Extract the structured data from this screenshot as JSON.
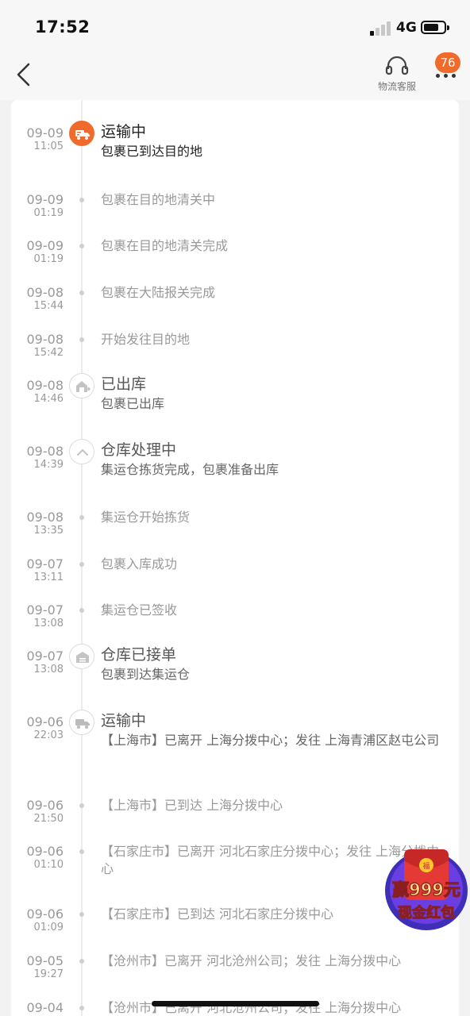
{
  "statusbar": {
    "time": "17:52",
    "network": "4G"
  },
  "nav": {
    "cs_label": "物流客服",
    "badge": "76"
  },
  "timeline": [
    {
      "date": "09-09",
      "time": "11:05",
      "type": "status",
      "status": "运输中",
      "desc": "包裹已到达目的地",
      "icon": "truck-icon",
      "active": true
    },
    {
      "date": "09-09",
      "time": "01:19",
      "type": "dot",
      "desc": "包裹在目的地清关中"
    },
    {
      "date": "09-09",
      "time": "01:19",
      "type": "dot",
      "desc": "包裹在目的地清关完成"
    },
    {
      "date": "09-08",
      "time": "15:44",
      "type": "dot",
      "desc": "包裹在大陆报关完成"
    },
    {
      "date": "09-08",
      "time": "15:42",
      "type": "dot",
      "desc": "开始发往目的地"
    },
    {
      "date": "09-08",
      "time": "14:46",
      "type": "status",
      "status": "已出库",
      "desc": "包裹已出库",
      "icon": "warehouse-out-icon"
    },
    {
      "date": "09-08",
      "time": "14:39",
      "type": "status",
      "status": "仓库处理中",
      "desc": "集运仓拣货完成，包裹准备出库",
      "icon": "chevron-up-icon"
    },
    {
      "date": "09-08",
      "time": "13:35",
      "type": "dot",
      "desc": "集运仓开始拣货"
    },
    {
      "date": "09-07",
      "time": "13:11",
      "type": "dot",
      "desc": "包裹入库成功"
    },
    {
      "date": "09-07",
      "time": "13:08",
      "type": "dot",
      "desc": "集运仓已签收"
    },
    {
      "date": "09-07",
      "time": "13:08",
      "type": "status",
      "status": "仓库已接单",
      "desc": "包裹到达集运仓",
      "icon": "warehouse-icon"
    },
    {
      "date": "09-06",
      "time": "22:03",
      "type": "status",
      "status": "运输中",
      "desc": "【上海市】已离开 上海分拨中心；发往 上海青浦区赵屯公司",
      "icon": "truck-icon"
    },
    {
      "date": "09-06",
      "time": "21:50",
      "type": "dot",
      "desc": "【上海市】已到达 上海分拨中心"
    },
    {
      "date": "09-06",
      "time": "01:10",
      "type": "dot",
      "desc": "【石家庄市】已离开 河北石家庄分拨中心；发往 上海分拨中心"
    },
    {
      "date": "09-06",
      "time": "01:09",
      "type": "dot",
      "desc": "【石家庄市】已到达 河北石家庄分拨中心"
    },
    {
      "date": "09-05",
      "time": "19:27",
      "type": "dot",
      "desc": "【沧州市】已离开 河北沧州公司；发往 上海分拨中心"
    },
    {
      "date": "09-04",
      "time": "",
      "type": "dot",
      "desc": "【沧州市】已离开 河北沧州公司；发往 上海分拨中心"
    }
  ],
  "promo": {
    "line1": "赢999元",
    "line2": "现金红包"
  }
}
